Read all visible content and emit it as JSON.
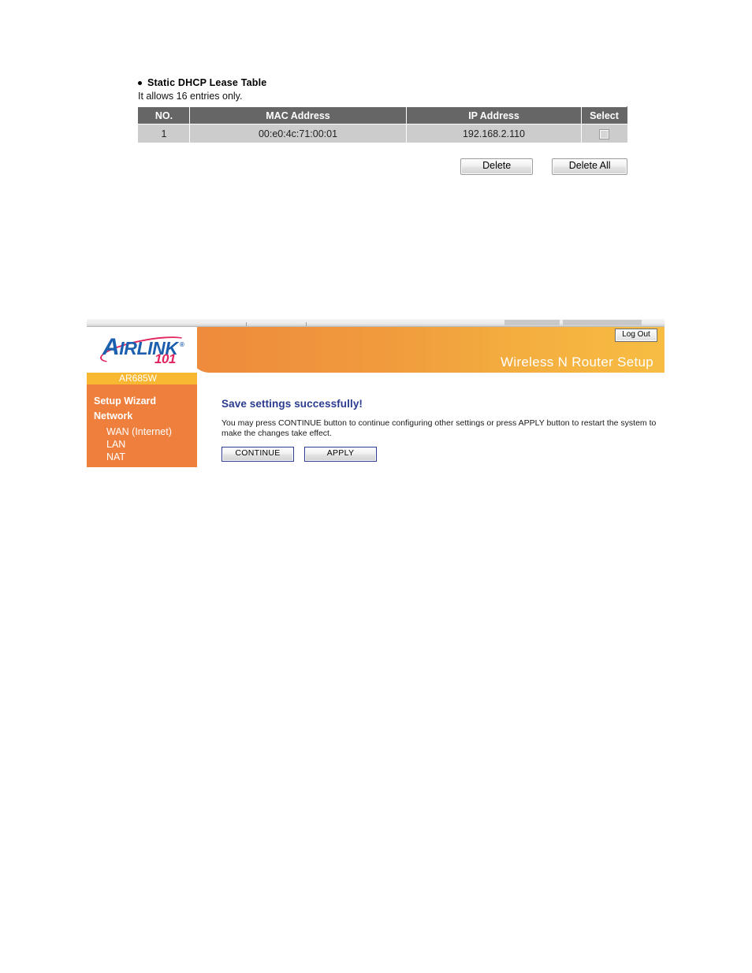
{
  "dhcp_section": {
    "heading": "Static DHCP Lease Table",
    "subtext": "It allows 16 entries only.",
    "columns": [
      "NO.",
      "MAC Address",
      "IP Address",
      "Select"
    ],
    "rows": [
      {
        "no": "1",
        "mac": "00:e0:4c:71:00:01",
        "ip": "192.168.2.110",
        "selected": false
      }
    ],
    "buttons": {
      "delete": "Delete",
      "delete_all": "Delete All"
    }
  },
  "router_panel": {
    "logo": {
      "wordmark_a": "A",
      "wordmark_rest": "IRLINK",
      "registered": "®",
      "suffix": "101"
    },
    "model_badge": "AR685W",
    "banner_title": "Wireless N Router Setup",
    "logout_label": "Log Out",
    "sidebar": {
      "groups": [
        {
          "label": "Setup Wizard"
        },
        {
          "label": "Network"
        }
      ],
      "items": [
        {
          "label": "WAN (Internet)"
        },
        {
          "label": "LAN"
        },
        {
          "label": "NAT"
        }
      ]
    },
    "main": {
      "title": "Save settings successfully!",
      "description": "You may press CONTINUE button to continue configuring other settings or press APPLY button to restart the system to make the changes take effect.",
      "buttons": {
        "continue": "CONTINUE",
        "apply": "APPLY"
      }
    }
  },
  "colors": {
    "sidebar_orange": "#ee7f3c",
    "badge_amber": "#f8b831",
    "banner_start": "#ee8a3c",
    "banner_end": "#f7bd43",
    "logo_blue": "#1b5fae",
    "logo_magenta": "#e2245f",
    "title_navy": "#2b3b8f",
    "table_header_grey": "#666666",
    "table_row_grey": "#cccccc"
  }
}
